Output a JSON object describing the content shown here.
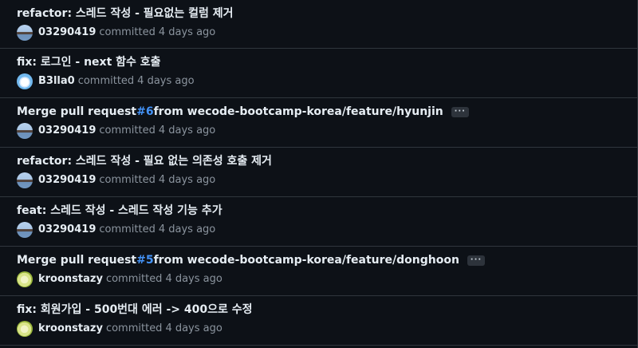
{
  "commits": [
    {
      "title": "refactor: 스레드 작성 - 필요없는 컬럼 제거",
      "author": "03290419",
      "action": "committed",
      "time": "4 days ago",
      "avatar": "avatar-a"
    },
    {
      "title": "fix: 로그인 - next 함수 호출",
      "author": "B3lla0",
      "action": "committed",
      "time": "4 days ago",
      "avatar": "avatar-b"
    },
    {
      "title_prefix": "Merge pull request ",
      "pr_number": "#6",
      "title_suffix": " from wecode-bootcamp-korea/feature/hyunjin",
      "ellipsis": "···",
      "author": "03290419",
      "action": "committed",
      "time": "4 days ago",
      "avatar": "avatar-a"
    },
    {
      "title": "refactor: 스레드 작성 - 필요 없는 의존성 호출 제거",
      "author": "03290419",
      "action": "committed",
      "time": "4 days ago",
      "avatar": "avatar-a"
    },
    {
      "title": "feat: 스레드 작성 - 스레드 작성 기능 추가",
      "author": "03290419",
      "action": "committed",
      "time": "4 days ago",
      "avatar": "avatar-a"
    },
    {
      "title_prefix": "Merge pull request ",
      "pr_number": "#5",
      "title_suffix": " from wecode-bootcamp-korea/feature/donghoon",
      "ellipsis": "···",
      "author": "kroonstazy",
      "action": "committed",
      "time": "4 days ago",
      "avatar": "avatar-c"
    },
    {
      "title": "fix: 회원가입 - 500번대 에러 -> 400으로 수정",
      "author": "kroonstazy",
      "action": "committed",
      "time": "4 days ago",
      "avatar": "avatar-c"
    }
  ]
}
